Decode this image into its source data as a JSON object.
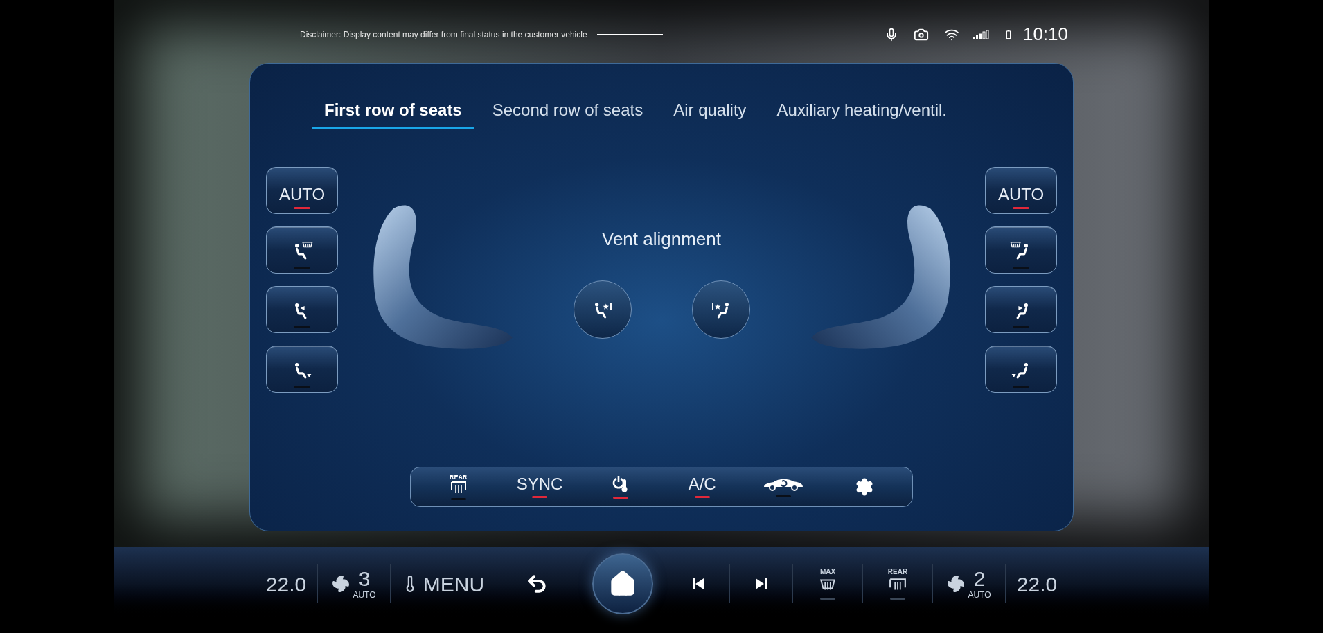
{
  "status_bar": {
    "disclaimer": "Disclaimer: Display content may differ from final status in the customer vehicle",
    "time": "10:10"
  },
  "tabs": [
    {
      "label": "First row of seats",
      "selected": true
    },
    {
      "label": "Second row of seats",
      "selected": false
    },
    {
      "label": "Air quality",
      "selected": false
    },
    {
      "label": "Auxiliary heating/ventil.",
      "selected": false
    }
  ],
  "left_controls": [
    {
      "kind": "auto",
      "label": "AUTO",
      "active": true
    },
    {
      "kind": "windshield",
      "active": false
    },
    {
      "kind": "face",
      "active": false
    },
    {
      "kind": "feet",
      "active": false
    }
  ],
  "vent_alignment": {
    "title": "Vent alignment"
  },
  "right_controls": [
    {
      "kind": "auto",
      "label": "AUTO",
      "active": true
    },
    {
      "kind": "windshield",
      "active": false
    },
    {
      "kind": "face",
      "active": false
    },
    {
      "kind": "feet",
      "active": false
    }
  ],
  "bottom_controls": [
    {
      "kind": "rear-defrost",
      "label": "REAR",
      "active": false
    },
    {
      "kind": "text",
      "label": "SYNC",
      "active": true
    },
    {
      "kind": "climate",
      "active": true
    },
    {
      "kind": "text",
      "label": "A/C",
      "active": true
    },
    {
      "kind": "recirculation",
      "active": false
    },
    {
      "kind": "settings"
    }
  ],
  "dock": [
    {
      "kind": "temperature",
      "label": "22.0"
    },
    {
      "kind": "fan",
      "label": "3",
      "sublabel": "AUTO"
    },
    {
      "kind": "menu",
      "label": "MENU"
    },
    {
      "kind": "back"
    },
    {
      "kind": "home"
    },
    {
      "kind": "previous"
    },
    {
      "kind": "next"
    },
    {
      "kind": "defrost",
      "label": "MAX",
      "active": false
    },
    {
      "kind": "rear-defrost",
      "label": "REAR",
      "active": false
    },
    {
      "kind": "fan",
      "label": "2",
      "sublabel": "AUTO"
    },
    {
      "kind": "temperature",
      "label": "22.0"
    }
  ]
}
